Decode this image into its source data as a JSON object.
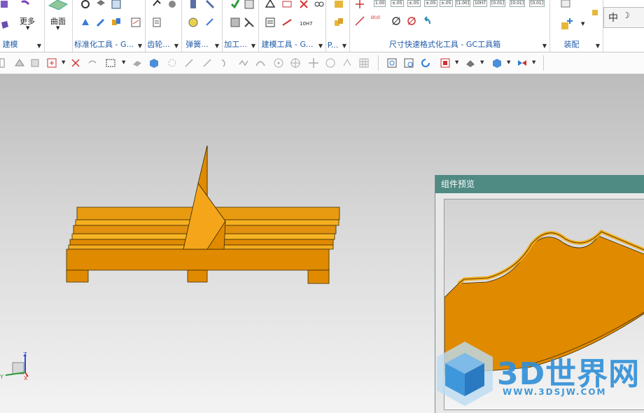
{
  "ribbon": {
    "groups": [
      {
        "label": "建模"
      },
      {
        "label": ""
      },
      {
        "label": "标准化工具 - G..."
      },
      {
        "label": "齿轮..."
      },
      {
        "label": "弹簧..."
      },
      {
        "label": "加工..."
      },
      {
        "label": "建模工具 - G..."
      },
      {
        "label": "P..."
      },
      {
        "label": "尺寸快速格式化工具 - GC工具箱"
      },
      {
        "label": "装配"
      }
    ],
    "more_label": "更多",
    "surface_label": "曲面",
    "tool_10h7": "10H7",
    "format_samples": [
      "1.00",
      "±.05",
      "±.05",
      "±.05",
      "±.05",
      "[1.00]",
      "10H7",
      "[0.01]",
      "[0.01]",
      "[0.01]"
    ],
    "dim_label": "Ø(d)",
    "ime_char": "中"
  },
  "panel": {
    "title": "组件预览"
  },
  "watermark": {
    "text": "3D世界网",
    "url": "WWW.3DSJW.COM"
  },
  "triad": {
    "z": "Z",
    "y": "Y",
    "x": "X"
  },
  "colors": {
    "part_orange": "#e08a00",
    "part_light": "#f5ad1e",
    "panel_title": "#4f8a83",
    "group_label": "#1f5aa6",
    "watermark": "#2f8fd8"
  }
}
